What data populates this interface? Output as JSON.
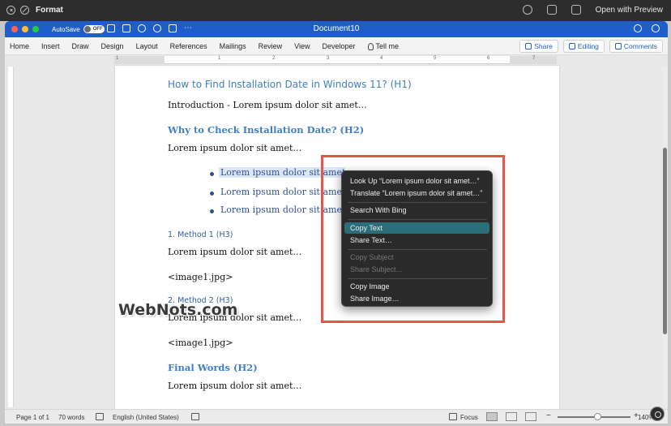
{
  "preview": {
    "title": "Format",
    "open_with": "Open with Preview"
  },
  "word": {
    "autosave_label": "AutoSave",
    "autosave_state": "OFF",
    "doc_title": "Document10",
    "tb_more": "⋯",
    "tabs": [
      "Home",
      "Insert",
      "Draw",
      "Design",
      "Layout",
      "References",
      "Mailings",
      "Review",
      "View",
      "Developer"
    ],
    "tell_me": "Tell me",
    "share": "Share",
    "editing": "Editing",
    "comments": "Comments",
    "ruler_numbers": [
      "1",
      "1",
      "2",
      "3",
      "4",
      "5",
      "6",
      "7"
    ]
  },
  "document": {
    "h1": "How to Find Installation Date in Windows 11? (H1)",
    "intro": "Introduction - Lorem ipsum dolor sit amet…",
    "h2_why": "Why to Check Installation Date? (H2)",
    "para1": "Lorem ipsum dolor sit amet…",
    "bullets": [
      "Lorem ipsum dolor sit amet",
      "Lorem ipsum dolor sit amet",
      "Lorem ipsum dolor sit amet"
    ],
    "h3_method1": "1. Method 1 (H3)",
    "para2": "Lorem ipsum dolor sit amet…",
    "image1a": "<image1.jpg>",
    "h3_method2": "2. Method 2 (H3)",
    "para3": "Lorem ipsum dolor sit amet…",
    "image1b": "<image1.jpg>",
    "h2_final": "Final Words (H2)",
    "para4": "Lorem ipsum dolor sit amet…"
  },
  "context_menu": {
    "look_up": "Look Up “Lorem ipsum dolor sit amet…”",
    "translate": "Translate “Lorem ipsum dolor sit amet…”",
    "search_bing": "Search With Bing",
    "copy_text": "Copy Text",
    "share_text": "Share Text…",
    "copy_subject": "Copy Subject",
    "share_subject": "Share Subject…",
    "copy_image": "Copy Image",
    "share_image": "Share Image…"
  },
  "status": {
    "page": "Page 1 of 1",
    "words": "70 words",
    "language": "English (United States)",
    "focus": "Focus",
    "zoom": "140%"
  },
  "watermark": "WebNots.com",
  "colors": {
    "word_blue": "#1f5ec8",
    "heading_blue": "#3f7fc4",
    "highlight_red": "#e2574c",
    "menu_selected": "#2a6e79"
  }
}
